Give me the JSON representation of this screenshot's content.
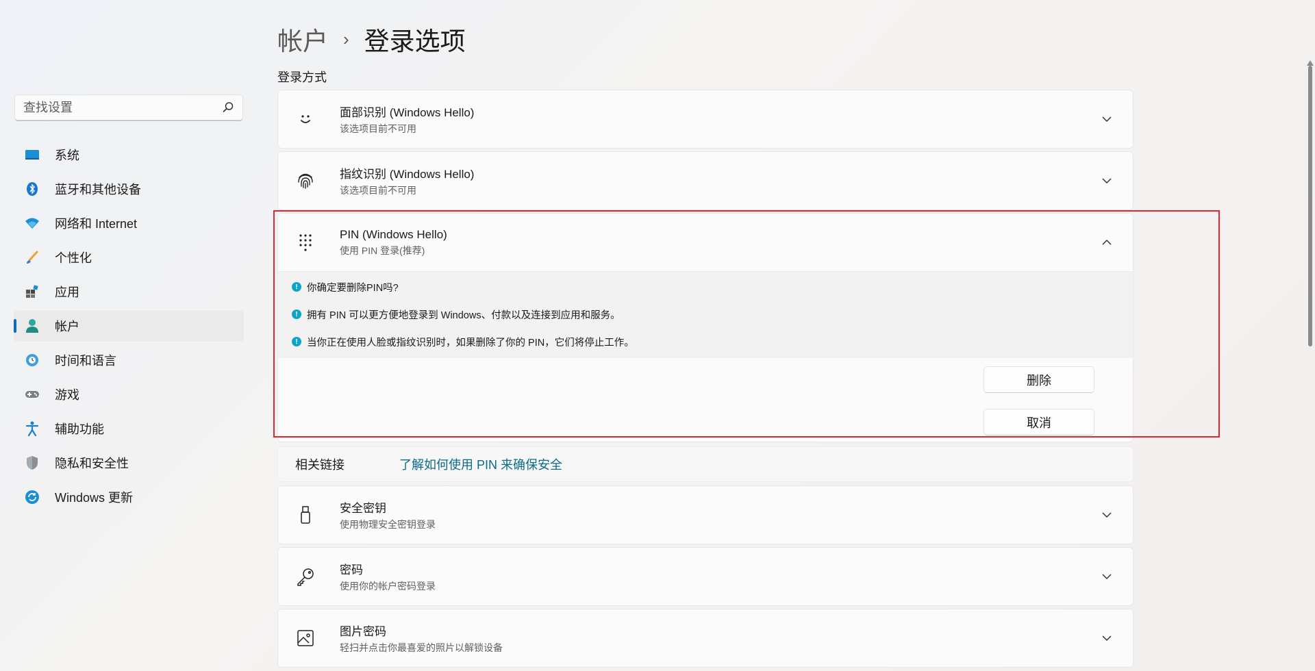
{
  "search": {
    "placeholder": "查找设置"
  },
  "sidebar": {
    "items": [
      {
        "label": "系统",
        "icon": "monitor-icon"
      },
      {
        "label": "蓝牙和其他设备",
        "icon": "bluetooth-icon"
      },
      {
        "label": "网络和 Internet",
        "icon": "wifi-icon"
      },
      {
        "label": "个性化",
        "icon": "brush-icon"
      },
      {
        "label": "应用",
        "icon": "apps-icon"
      },
      {
        "label": "帐户",
        "icon": "person-icon",
        "active": true
      },
      {
        "label": "时间和语言",
        "icon": "globe-clock-icon"
      },
      {
        "label": "游戏",
        "icon": "gamepad-icon"
      },
      {
        "label": "辅助功能",
        "icon": "accessibility-icon"
      },
      {
        "label": "隐私和安全性",
        "icon": "shield-icon"
      },
      {
        "label": "Windows 更新",
        "icon": "update-icon"
      }
    ]
  },
  "header": {
    "parent": "帐户",
    "separator": "›",
    "current": "登录选项"
  },
  "section": {
    "label": "登录方式"
  },
  "cards": {
    "face": {
      "title": "面部识别 (Windows Hello)",
      "subtitle": "该选项目前不可用",
      "icon": "smile-icon"
    },
    "fingerprint": {
      "title": "指纹识别 (Windows Hello)",
      "subtitle": "该选项目前不可用",
      "icon": "fingerprint-icon"
    },
    "pin": {
      "title": "PIN (Windows Hello)",
      "subtitle": "使用 PIN 登录(推荐)",
      "icon": "keypad-icon",
      "messages": [
        "你确定要删除PIN吗?",
        "拥有 PIN 可以更方便地登录到 Windows、付款以及连接到应用和服务。",
        "当你正在使用人脸或指纹识别时，如果删除了你的 PIN，它们将停止工作。"
      ],
      "delete_label": "删除",
      "cancel_label": "取消"
    },
    "security_key": {
      "title": "安全密钥",
      "subtitle": "使用物理安全密钥登录",
      "icon": "usb-key-icon"
    },
    "password": {
      "title": "密码",
      "subtitle": "使用你的帐户密码登录",
      "icon": "key-icon"
    },
    "picture_password": {
      "title": "图片密码",
      "subtitle": "轻扫并点击你最喜爱的照片以解锁设备",
      "icon": "image-icon"
    }
  },
  "related": {
    "label": "相关链接",
    "link": "了解如何使用 PIN 来确保安全"
  },
  "colors": {
    "accent": "#0f6cbd",
    "highlight_border": "#e0272f",
    "link": "#0b6a8a",
    "info": "#11a3c4"
  }
}
